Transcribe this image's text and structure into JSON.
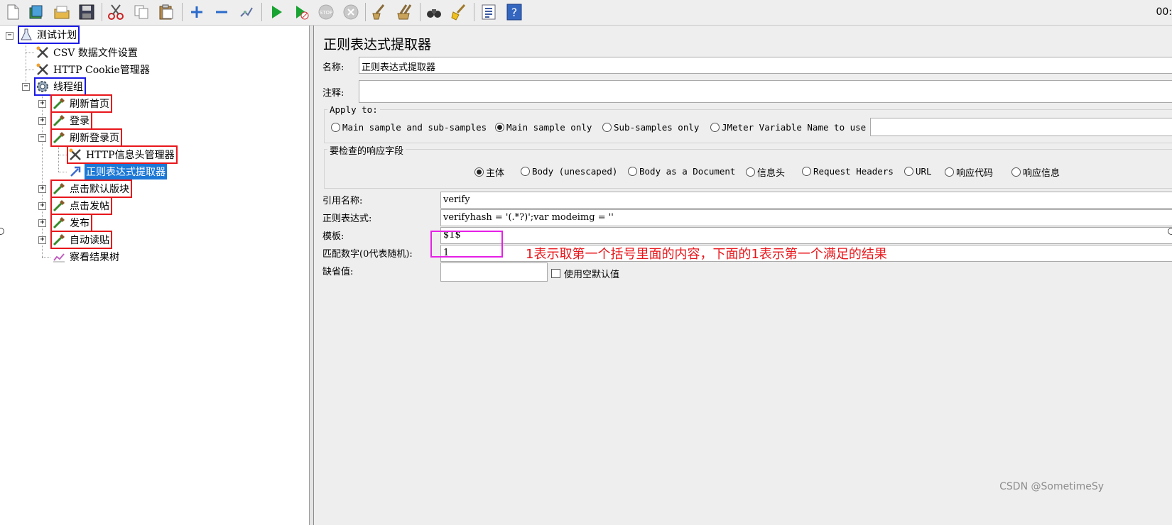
{
  "toolbar": {
    "clock": "00:",
    "buttons": [
      "new-icon",
      "templates-icon",
      "open-icon",
      "save-icon",
      "cut-icon",
      "copy-icon",
      "paste-icon",
      "expand-icon",
      "collapse-icon",
      "toggle-icon",
      "start-icon",
      "start-no-pause-icon",
      "stop-icon",
      "shutdown-icon",
      "clear-icon",
      "clear-all-icon",
      "search-icon",
      "reset-search-icon",
      "function-helper-icon",
      "help-icon"
    ]
  },
  "tree": {
    "test_plan": "测试计划",
    "csv": "CSV 数据文件设置",
    "cookie": "HTTP Cookie管理器",
    "thread_group": "线程组",
    "refresh_home": "刷新首页",
    "login": "登录",
    "refresh_login": "刷新登录页",
    "http_header": "HTTP信息头管理器",
    "regex_extractor": "正则表达式提取器",
    "click_default": "点击默认版块",
    "click_post": "点击发帖",
    "publish": "发布",
    "auto_read": "自动读贴",
    "result_tree": "察看结果树"
  },
  "panel": {
    "title": "正则表达式提取器",
    "name_label": "名称:",
    "name_value": "正则表达式提取器",
    "comment_label": "注释:",
    "comment_value": "",
    "apply_to": {
      "title": "Apply to:",
      "options": [
        "Main sample and sub-samples",
        "Main sample only",
        "Sub-samples only",
        "JMeter Variable Name to use"
      ],
      "selected": 1,
      "variable_value": ""
    },
    "response_field": {
      "title": "要检查的响应字段",
      "options": [
        "主体",
        "Body (unescaped)",
        "Body as a Document",
        "信息头",
        "Request Headers",
        "URL",
        "响应代码",
        "响应信息"
      ],
      "selected": 0
    },
    "ref_name_label": "引用名称:",
    "ref_name_value": "verify",
    "regex_label": "正则表达式:",
    "regex_value": "verifyhash = '(.*?)';var modeimg = ''",
    "template_label": "模板:",
    "template_value": "$1$",
    "match_no_label": "匹配数字(0代表随机):",
    "match_no_value": "1",
    "default_label": "缺省值:",
    "default_value": "",
    "use_empty_label": "使用空默认值"
  },
  "annotation": "1表示取第一个括号里面的内容，下面的1表示第一个满足的结果",
  "watermark": "CSDN @SometimeSy",
  "colors": {
    "highlight_red": "#e8161b",
    "highlight_blue": "#1a1ae6",
    "highlight_magenta": "#e620e6",
    "selection": "#1b78d6"
  }
}
